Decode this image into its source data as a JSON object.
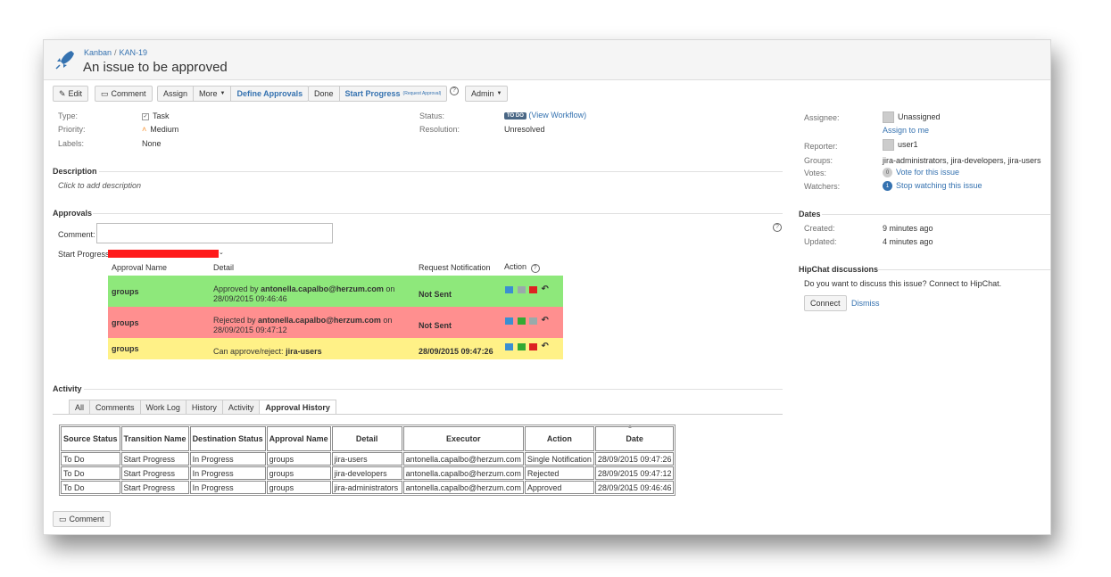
{
  "breadcrumb": {
    "project": "Kanban",
    "separator": "/",
    "issue_key": "KAN-19"
  },
  "issue_title": "An issue to be approved",
  "toolbar": {
    "edit": "Edit",
    "comment": "Comment",
    "assign": "Assign",
    "more": "More",
    "define_approvals": "Define Approvals",
    "done": "Done",
    "start_progress": "Start Progress",
    "request_approval": "(Request Approval)",
    "admin": "Admin"
  },
  "details": {
    "type_label": "Type:",
    "type_value": "Task",
    "priority_label": "Priority:",
    "priority_value": "Medium",
    "labels_label": "Labels:",
    "labels_value": "None",
    "status_label": "Status:",
    "status_value": "TO DO",
    "view_workflow": "(View Workflow)",
    "resolution_label": "Resolution:",
    "resolution_value": "Unresolved"
  },
  "description": {
    "title": "Description",
    "placeholder": "Click to add description"
  },
  "approvals": {
    "title": "Approvals",
    "comment_label": "Comment:",
    "start_progress_label": "Start Progress",
    "headers": {
      "name": "Approval Name",
      "detail": "Detail",
      "notification": "Request Notification",
      "action": "Action"
    },
    "rows": [
      {
        "name": "groups",
        "detail_prefix": "Approved by",
        "detail_user": "antonella.capalbo@herzum.com",
        "detail_suffix": "on",
        "detail_date": "28/09/2015 09:46:46",
        "notification": "Not Sent",
        "color": "#8ee87b"
      },
      {
        "name": "groups",
        "detail_prefix": "Rejected by",
        "detail_user": "antonella.capalbo@herzum.com",
        "detail_suffix": "on",
        "detail_date": "28/09/2015 09:47:12",
        "notification": "Not Sent",
        "color": "#ff8f8f"
      },
      {
        "name": "groups",
        "detail_prefix": "Can approve/reject:",
        "detail_user": "jira-users",
        "notification": "28/09/2015 09:47:26",
        "color": "#fff187"
      }
    ]
  },
  "activity": {
    "title": "Activity",
    "tabs": [
      "All",
      "Comments",
      "Work Log",
      "History",
      "Activity",
      "Approval History"
    ],
    "active_tab": "Approval History",
    "table": {
      "headers": [
        "Source Status",
        "Transition Name",
        "Destination Status",
        "Approval Name",
        "Detail",
        "Executor",
        "Action",
        "Date"
      ],
      "rows": [
        [
          "To Do",
          "Start Progress",
          "In Progress",
          "groups",
          "jira-users",
          "antonella.capalbo@herzum.com",
          "Single Notification",
          "28/09/2015 09:47:26"
        ],
        [
          "To Do",
          "Start Progress",
          "In Progress",
          "groups",
          "jira-developers",
          "antonella.capalbo@herzum.com",
          "Rejected",
          "28/09/2015 09:47:12"
        ],
        [
          "To Do",
          "Start Progress",
          "In Progress",
          "groups",
          "jira-administrators",
          "antonella.capalbo@herzum.com",
          "Approved",
          "28/09/2015 09:46:46"
        ]
      ]
    },
    "comment_button": "Comment"
  },
  "people": {
    "assignee_label": "Assignee:",
    "assignee_value": "Unassigned",
    "assign_to_me": "Assign to me",
    "reporter_label": "Reporter:",
    "reporter_value": "user1",
    "groups_label": "Groups:",
    "groups_value": "jira-administrators, jira-developers, jira-users",
    "votes_label": "Votes:",
    "votes_count": "0",
    "vote_link": "Vote for this issue",
    "watchers_label": "Watchers:",
    "watchers_count": "1",
    "watch_link": "Stop watching this issue"
  },
  "dates": {
    "title": "Dates",
    "created_label": "Created:",
    "created_value": "9 minutes ago",
    "updated_label": "Updated:",
    "updated_value": "4 minutes ago"
  },
  "hipchat": {
    "title": "HipChat discussions",
    "text": "Do you want to discuss this issue? Connect to HipChat.",
    "connect": "Connect",
    "dismiss": "Dismiss"
  },
  "colors": {
    "link": "#3572b0",
    "approved": "#8ee87b",
    "rejected": "#ff8f8f",
    "pending": "#fff187"
  }
}
